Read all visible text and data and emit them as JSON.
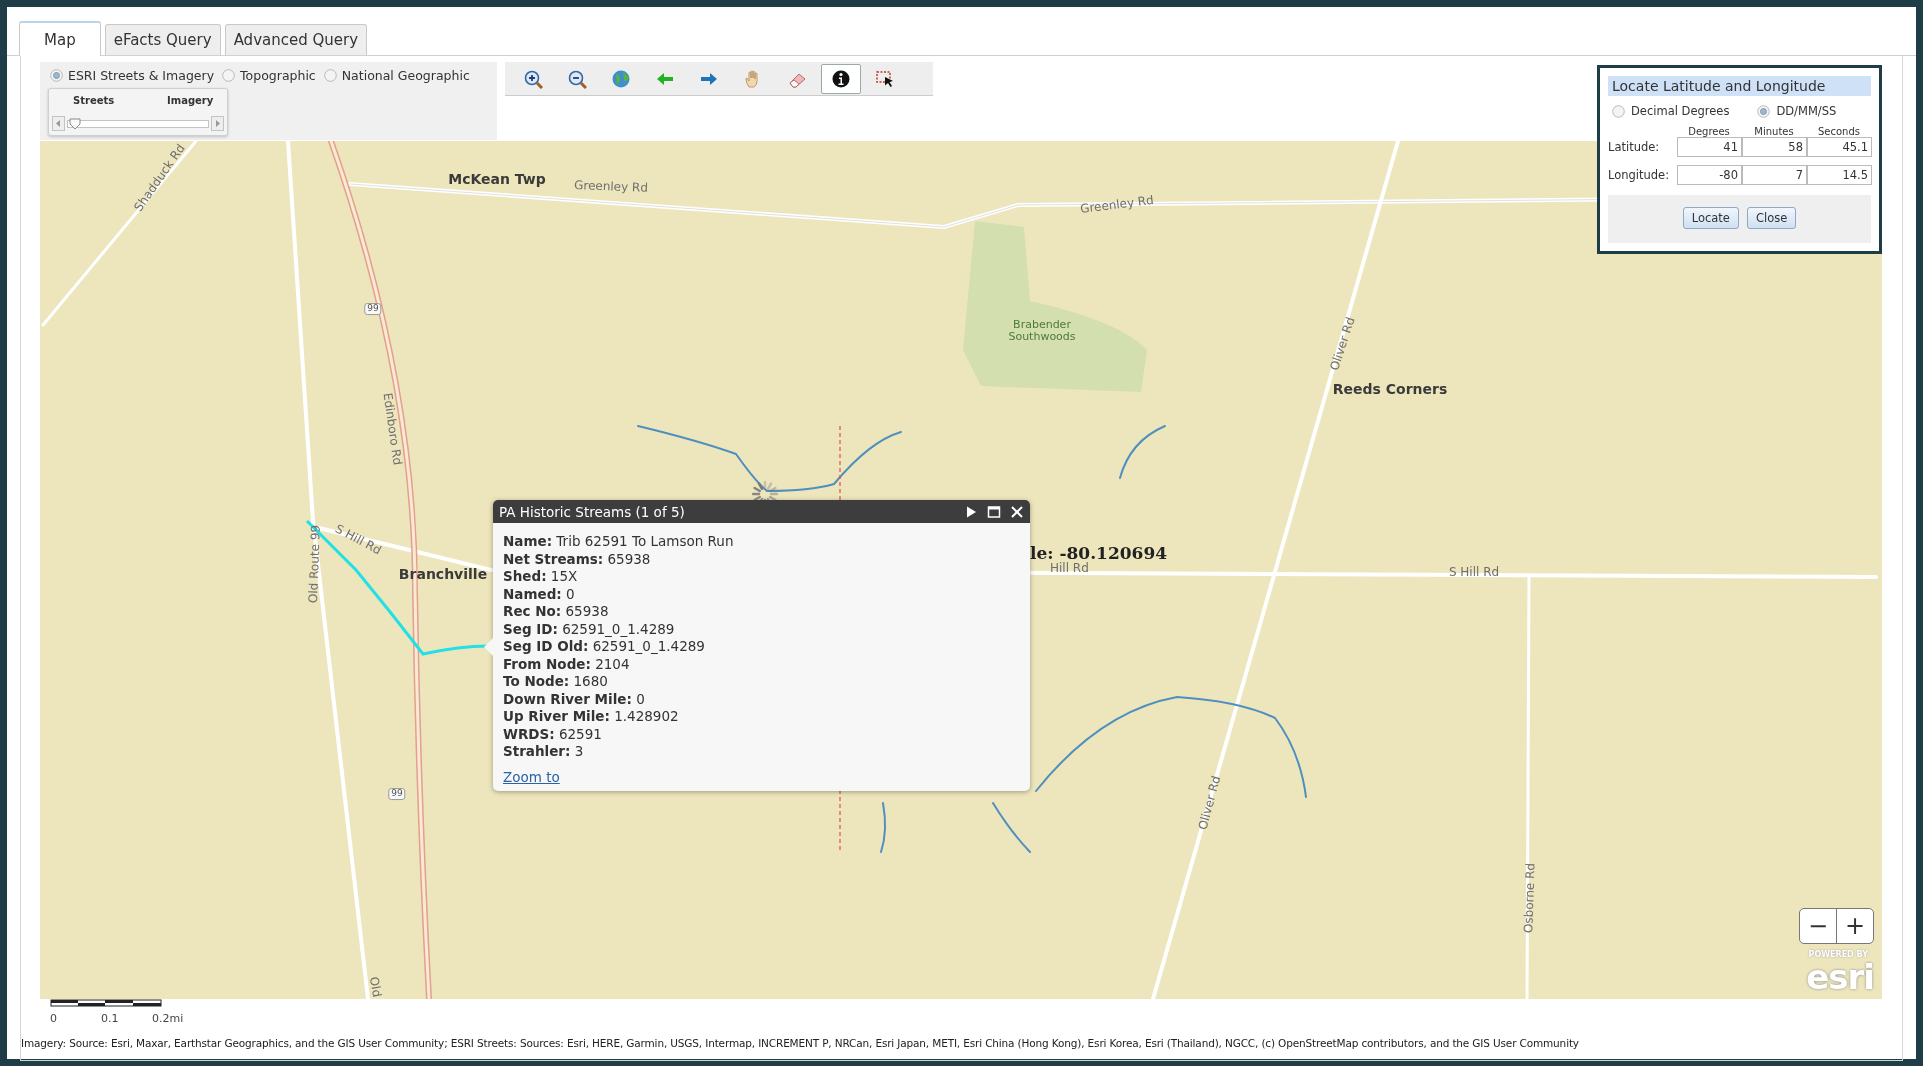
{
  "tabs": [
    {
      "label": "Map",
      "selected": true
    },
    {
      "label": "eFacts Query",
      "selected": false
    },
    {
      "label": "Advanced Query",
      "selected": false
    }
  ],
  "basemaps": [
    {
      "label": "ESRI Streets & Imagery",
      "selected": true
    },
    {
      "label": "Topographic",
      "selected": false
    },
    {
      "label": "National Geographic",
      "selected": false
    }
  ],
  "basemap_slider": {
    "left_label": "Streets",
    "right_label": "Imagery",
    "level": 0.05
  },
  "tools": [
    {
      "kind": "zoom-in",
      "selected": false
    },
    {
      "kind": "zoom-out",
      "selected": false
    },
    {
      "kind": "globe",
      "selected": false
    },
    {
      "kind": "back",
      "selected": false
    },
    {
      "kind": "forward",
      "selected": false
    },
    {
      "kind": "pan",
      "selected": false
    },
    {
      "kind": "eraser",
      "selected": false
    },
    {
      "kind": "info",
      "selected": true
    },
    {
      "kind": "select",
      "selected": false
    }
  ],
  "map": {
    "labels": [
      {
        "kind": "road",
        "text": "Shadduck Rd"
      },
      {
        "kind": "place",
        "text": "McKean Twp"
      },
      {
        "kind": "road",
        "text": "Greenley Rd"
      },
      {
        "kind": "shield",
        "text": "99"
      },
      {
        "kind": "road",
        "text": "Edinboro Rd"
      },
      {
        "kind": "road",
        "text": "Greenley Rd"
      },
      {
        "kind": "area",
        "text": "Brabender Southwoods"
      },
      {
        "kind": "road",
        "text": "Oliver Rd"
      },
      {
        "kind": "place",
        "text": "Reeds Corners"
      },
      {
        "kind": "road",
        "text": "S Hill Rd"
      },
      {
        "kind": "road",
        "text": "Old Route 99"
      },
      {
        "kind": "place",
        "text": "Branchville"
      },
      {
        "kind": "coordinate",
        "text": "le: -80.120694"
      },
      {
        "kind": "road",
        "text": "Hill Rd"
      },
      {
        "kind": "road",
        "text": "S Hill Rd"
      },
      {
        "kind": "road",
        "text": "Oliver Rd"
      },
      {
        "kind": "road",
        "text": "Osborne Rd"
      },
      {
        "kind": "shield",
        "text": "99"
      },
      {
        "kind": "road",
        "text": "Old"
      }
    ],
    "zoom_controls": [
      "−",
      "+"
    ],
    "powered_by": "POWERED BY",
    "logo": "esri"
  },
  "popup": {
    "title": "PA Historic Streams (1 of 5)",
    "fields": [
      "**Name:** Trib 62591 To Lamson Run",
      "**Net Streams:** 65938",
      "**Shed:** 15X",
      "**Named:** 0",
      "**Rec No:** 65938",
      "**Seg ID:** 62591_0_1.4289",
      "**Seg ID Old:** 62591_0_1.4289",
      "**From Node:** 2104",
      "**To Node:** 1680",
      "**Down River Mile:** 0",
      "**Up River Mile:** 1.428902",
      "**WRDS:** 62591",
      "**Strahler:** 3"
    ],
    "link": "Zoom to"
  },
  "locate_panel": {
    "title": "Locate Latitude and Longitude",
    "formats": [
      {
        "label": "Decimal Degrees",
        "selected": false
      },
      {
        "label": "DD/MM/SS",
        "selected": true
      }
    ],
    "columns": [
      "Degrees",
      "Minutes",
      "Seconds"
    ],
    "rows": [
      {
        "label": "Latitude:",
        "values": [
          "41",
          "58",
          "45.1"
        ]
      },
      {
        "label": "Longitude:",
        "values": [
          "-80",
          "7",
          "14.5"
        ]
      }
    ],
    "buttons": [
      "Locate",
      "Close"
    ]
  },
  "scale": [
    "0",
    "0.1",
    "0.2mi"
  ],
  "attribution": "Imagery: Source: Esri, Maxar, Earthstar Geographics, and the GIS User Community; ESRI Streets: Sources: Esri, HERE, Garmin, USGS, Intermap, INCREMENT P, NRCan, Esri Japan, METI, Esri China (Hong Kong), Esri Korea, Esri (Thailand), NGCC, (c) OpenStreetMap contributors, and the GIS User Community"
}
